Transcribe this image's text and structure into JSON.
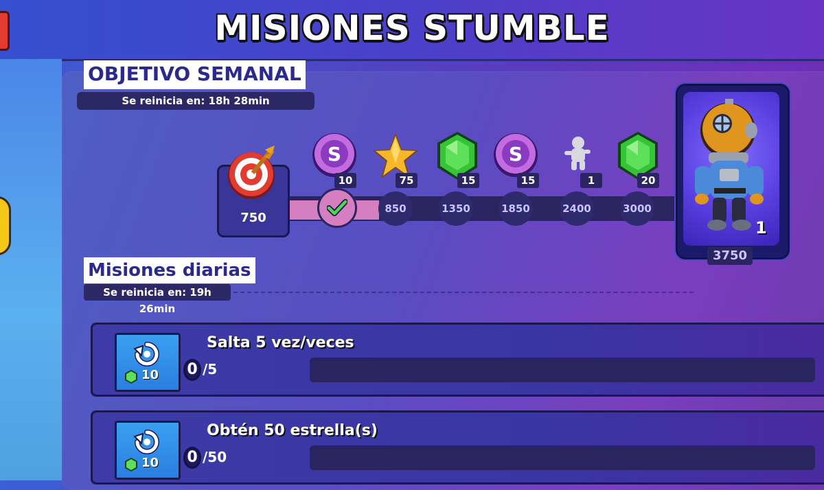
{
  "header": {
    "title": "MISIONES STUMBLE"
  },
  "weekly": {
    "label": "OBJETIVO SEMANAL",
    "reset": "Se reinicia en: 18h 28min",
    "start_value": "750",
    "rewards": [
      {
        "icon": "stumble-token-icon",
        "qty": "10",
        "threshold": ""
      },
      {
        "icon": "star-icon",
        "qty": "75",
        "threshold": "850"
      },
      {
        "icon": "gem-icon",
        "qty": "15",
        "threshold": "1350"
      },
      {
        "icon": "stumble-token-icon",
        "qty": "15",
        "threshold": "1850"
      },
      {
        "icon": "emote-icon",
        "qty": "1",
        "threshold": "2400"
      },
      {
        "icon": "gem-icon",
        "qty": "20",
        "threshold": "3000"
      }
    ],
    "final_reward": {
      "qty": "1",
      "threshold": "3750"
    }
  },
  "daily": {
    "label": "Misiones diarias",
    "reset": "Se reinicia en: 19h 26min",
    "missions": [
      {
        "title": "Salta 5 vez/veces",
        "reward": "10",
        "current": "0",
        "total": "/5"
      },
      {
        "title": "Obtén 50 estrella(s)",
        "reward": "10",
        "current": "0",
        "total": "/50"
      }
    ]
  },
  "colors": {
    "accent": "#d67fc0",
    "track": "#2a2560",
    "gem": "#35c435",
    "label_text": "#2b2a8c"
  }
}
